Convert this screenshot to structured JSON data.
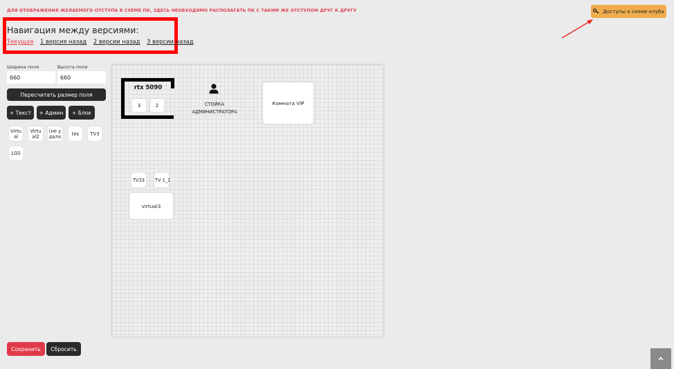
{
  "notice": "ДЛЯ ОТОБРАЖЕНИЯ ЖЕЛАЕМОГО ОТСТУПА В СХЕМЕ ПК, ЗДЕСЬ НЕОБХОДИМО РАСПОЛАГАТЬ ПК С ТАКИМ ЖЕ ОТСТУПОМ ДРУГ К ДРУГУ",
  "access_button": {
    "label": "Доступы к схеме клуба",
    "icon": "key-icon"
  },
  "version_nav": {
    "title": "Навигация между версиями:",
    "links": [
      "Текущая",
      "1 версия назад",
      "2 версии назад",
      "3 версии назад"
    ]
  },
  "field": {
    "width_label": "Ширина поля",
    "width_value": "660",
    "height_label": "Высота поля",
    "height_value": "660",
    "recalc_label": "Пересчитать размер поля"
  },
  "add_buttons": {
    "text": "+ Текст",
    "admin": "+ Админ",
    "block": "+ Блок"
  },
  "palette": [
    "Virtu al",
    "Virtu al2",
    "(не у дала",
    "tes",
    "TV3",
    "LGS"
  ],
  "canvas": {
    "pc_group": {
      "title": "rtx 5090",
      "pcs": [
        "3",
        "2"
      ]
    },
    "admin_desk": {
      "label": "СТОЙКА АДМИНИСТРАТОРА"
    },
    "room_vip": "Комната VIP",
    "tv33": "TV33",
    "tv1_1": "TV 1_1",
    "virtual3": "virtual3"
  },
  "footer": {
    "save": "Сохранить",
    "reset": "Сбросить"
  },
  "colors": {
    "accent_red": "#e03a48",
    "access_orange": "#f0ad4e",
    "dark": "#2b2b2b",
    "highlight": "#ff0000"
  }
}
